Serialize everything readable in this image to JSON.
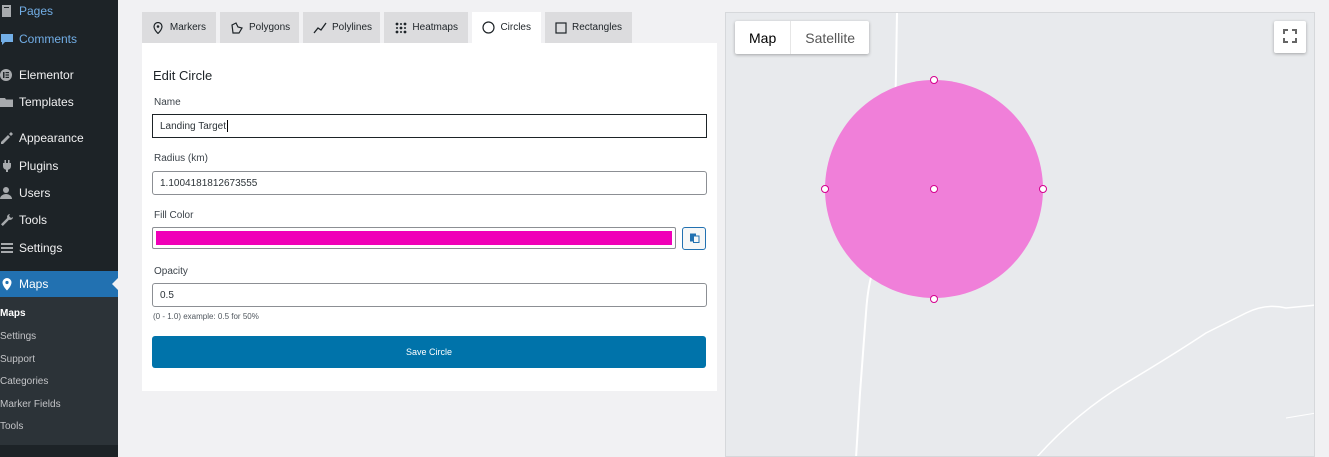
{
  "sidebar": {
    "items": [
      {
        "label": "Pages",
        "icon": "pages-icon"
      },
      {
        "label": "Comments",
        "icon": "comments-icon"
      },
      {
        "label": "Elementor",
        "icon": "elementor-icon"
      },
      {
        "label": "Templates",
        "icon": "templates-icon"
      },
      {
        "label": "Appearance",
        "icon": "appearance-icon"
      },
      {
        "label": "Plugins",
        "icon": "plugins-icon"
      },
      {
        "label": "Users",
        "icon": "users-icon"
      },
      {
        "label": "Tools",
        "icon": "tools-icon"
      },
      {
        "label": "Settings",
        "icon": "settings-icon"
      },
      {
        "label": "Maps",
        "icon": "map-pin-icon"
      }
    ],
    "submenu": [
      "Maps",
      "Settings",
      "Support",
      "Categories",
      "Marker Fields",
      "Tools"
    ],
    "accent": "#2271b1"
  },
  "tabs": [
    {
      "label": "Markers",
      "icon": "marker-icon"
    },
    {
      "label": "Polygons",
      "icon": "polygon-icon"
    },
    {
      "label": "Polylines",
      "icon": "polyline-icon"
    },
    {
      "label": "Heatmaps",
      "icon": "heatmap-icon"
    },
    {
      "label": "Circles",
      "icon": "circle-icon"
    },
    {
      "label": "Rectangles",
      "icon": "rectangle-icon"
    }
  ],
  "active_tab": "Circles",
  "form": {
    "title": "Edit Circle",
    "name_label": "Name",
    "name_value": "Landing Target",
    "radius_label": "Radius (km)",
    "radius_value": "1.1004181812673555",
    "fill_label": "Fill Color",
    "fill_color": "#f000b8",
    "opacity_label": "Opacity",
    "opacity_value": "0.5",
    "opacity_hint": "(0 - 1.0) example: 0.5 for 50%",
    "save_label": "Save Circle"
  },
  "map": {
    "type_buttons": [
      "Map",
      "Satellite"
    ],
    "active_type": "Map",
    "circle_fill": "#f07fd9",
    "circle_opacity": 0.5,
    "fullscreen_icon": "fullscreen-icon"
  }
}
